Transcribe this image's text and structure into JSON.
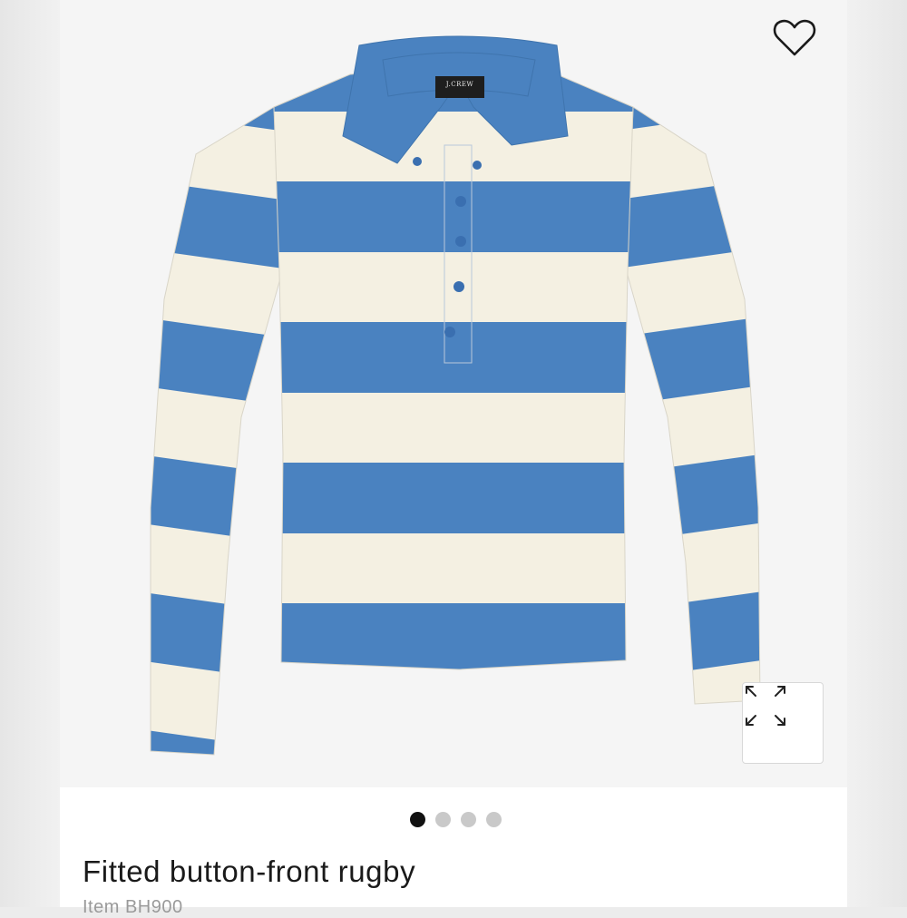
{
  "product": {
    "title": "Fitted button-front rugby",
    "item_code": "Item BH900",
    "brand_label": "J.CREW"
  },
  "gallery": {
    "image_count": 4,
    "active_index": 0
  },
  "icons": {
    "favorite": "heart-outline-icon",
    "zoom": "expand-arrows-icon"
  },
  "colors": {
    "stripe_blue": "#4a82c0",
    "stripe_cream": "#f4f0e2",
    "active_dot": "#111111",
    "inactive_dot": "#c9c9c9"
  }
}
